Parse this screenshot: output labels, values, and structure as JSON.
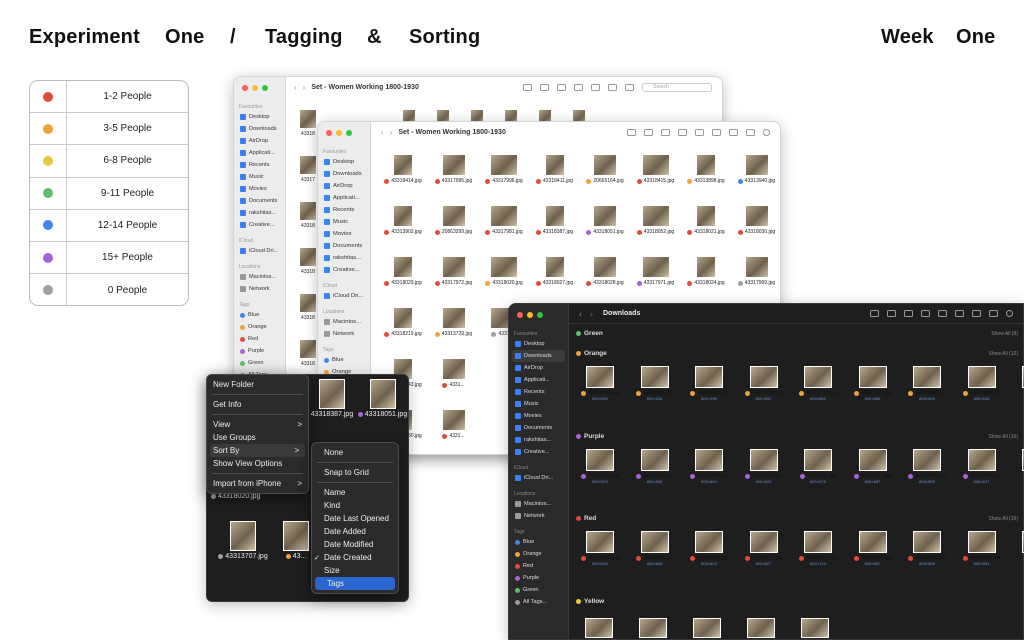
{
  "header": {
    "words": [
      "Experiment",
      "One",
      "/",
      "Tagging",
      "&",
      "Sorting"
    ],
    "right": [
      "Week",
      "One"
    ]
  },
  "legend": [
    {
      "label": "1-2 People",
      "color": "#e04b3c"
    },
    {
      "label": "3-5 People",
      "color": "#f0a23c"
    },
    {
      "label": "6-8 People",
      "color": "#e9c93c"
    },
    {
      "label": "9-11 People",
      "color": "#5cc06a"
    },
    {
      "label": "12-14 People",
      "color": "#3f86e8"
    },
    {
      "label": "15+ People",
      "color": "#a764d6"
    },
    {
      "label": "0 People",
      "color": "#a0a0a0"
    }
  ],
  "sidebar": {
    "favourites": "Favourites",
    "icloud": "iCloud",
    "locations": "Locations",
    "tags": "Tags",
    "fav_items": [
      "Desktop",
      "Downloads",
      "AirDrop",
      "Applicati...",
      "Recents",
      "Music",
      "Movies",
      "Documents",
      "rakshitas...",
      "Creative..."
    ],
    "icloud_items": [
      "iCloud Dri..."
    ],
    "loc_items": [
      "Macintos...",
      "Network"
    ],
    "tag_items": [
      {
        "label": "Blue",
        "color": "#3f86e8"
      },
      {
        "label": "Orange",
        "color": "#f0a23c"
      },
      {
        "label": "Red",
        "color": "#e04b3c"
      },
      {
        "label": "Purple",
        "color": "#a764d6"
      },
      {
        "label": "Green",
        "color": "#5cc06a"
      },
      {
        "label": "All Tags...",
        "color": "#999999"
      }
    ]
  },
  "back_window": {
    "title": "Set - Women Working 1800-1930",
    "search": "Search"
  },
  "front_window": {
    "title": "Set - Women Working 1800-1930",
    "rows": [
      [
        {
          "n": "43318414.jpg",
          "c": "#e04b3c"
        },
        {
          "n": "43317995.jpg",
          "c": "#e04b3c"
        },
        {
          "n": "43317996.jpg",
          "c": "#e04b3c"
        },
        {
          "n": "43318411.jpg",
          "c": "#e04b3c"
        },
        {
          "n": "20665164.jpg",
          "c": "#f0a23c"
        },
        {
          "n": "43318415.jpg",
          "c": "#e04b3c"
        },
        {
          "n": "43313898.jpg",
          "c": "#f0a23c"
        },
        {
          "n": "43313940.jpg",
          "c": "#3f86e8"
        }
      ],
      [
        {
          "n": "43313902.jpg",
          "c": "#e04b3c"
        },
        {
          "n": "20863299.jpg",
          "c": "#e04b3c"
        },
        {
          "n": "43317981.jpg",
          "c": "#e04b3c"
        },
        {
          "n": "43318387.jpg",
          "c": "#e04b3c"
        },
        {
          "n": "43318051.jpg",
          "c": "#a764d6"
        },
        {
          "n": "43318052.jpg",
          "c": "#e04b3c"
        },
        {
          "n": "43318021.jpg",
          "c": "#e04b3c"
        },
        {
          "n": "43318030.jpg",
          "c": "#e04b3c"
        }
      ],
      [
        {
          "n": "43318029.jpg",
          "c": "#e04b3c"
        },
        {
          "n": "43317972.jpg",
          "c": "#e04b3c"
        },
        {
          "n": "43318020.jpg",
          "c": "#f0a23c"
        },
        {
          "n": "43318027.jpg",
          "c": "#e04b3c"
        },
        {
          "n": "43318028.jpg",
          "c": "#e04b3c"
        },
        {
          "n": "43317971.jpg",
          "c": "#a764d6"
        },
        {
          "n": "43318024.jpg",
          "c": "#e04b3c"
        },
        {
          "n": "43317969.jpg",
          "c": "#a0a0a0"
        }
      ],
      [
        {
          "n": "43318219.jpg",
          "c": "#e04b3c"
        },
        {
          "n": "43313729.jpg",
          "c": "#f0a23c"
        },
        {
          "n": "43313...",
          "c": "#a0a0a0"
        }
      ],
      [
        {
          "n": "43318443.jpg",
          "c": "#e04b3c"
        },
        {
          "n": "4331...",
          "c": "#e04b3c"
        }
      ],
      [
        {
          "n": "43318130.jpg",
          "c": "#5cc06a"
        },
        {
          "n": "4331...",
          "c": "#e04b3c"
        }
      ]
    ]
  },
  "behind_labels": [
    "43318",
    "43317",
    "43318",
    "43318",
    "43318",
    "43318"
  ],
  "ctx_bg": {
    "top": [
      {
        "n": "43318387.jpg",
        "c": ""
      },
      {
        "n": "43318051.jpg",
        "c": "#a764d6"
      }
    ],
    "mid": {
      "n": "43318020.jpg",
      "c": "#a0a0a0"
    },
    "bottom": [
      {
        "n": "43313707.jpg",
        "c": "#a0a0a0"
      },
      {
        "n": "43...",
        "c": "#f0a23c"
      }
    ]
  },
  "context_menu": {
    "items": [
      "New Folder",
      "Get Info",
      "View",
      "Use Groups",
      "Sort By",
      "Show View Options",
      "Import from iPhone"
    ],
    "arrow": ">"
  },
  "submenu": {
    "items": [
      "None",
      "Snap to Grid",
      "Name",
      "Kind",
      "Date Last Opened",
      "Date Added",
      "Date Modified",
      "Date Created",
      "Size",
      "Tags"
    ],
    "check": "✓"
  },
  "downloads": {
    "title": "Downloads",
    "show_all": "Show All",
    "groups": [
      {
        "name": "Green",
        "color": "#5cc06a",
        "count": "(9)",
        "items": []
      },
      {
        "name": "Orange",
        "color": "#f0a23c",
        "count": "(12)",
        "items": [
          {
            "n": "20665164.jpg",
            "d": "800×550"
          },
          {
            "n": "43313655.jpg",
            "d": "800×628"
          },
          {
            "n": "43313668.jpg",
            "d": "800×990"
          },
          {
            "n": "43313729.jpg",
            "d": "800×650"
          },
          {
            "n": "43313733.jpg",
            "d": "800×659"
          },
          {
            "n": "43313760.jpg",
            "d": "800×585"
          },
          {
            "n": "43318020.jpg",
            "d": "800×669"
          },
          {
            "n": "43318029.jpg",
            "d": "800×635"
          },
          {
            "n": "433...",
            "d": ""
          }
        ]
      },
      {
        "name": "Purple",
        "color": "#a764d6",
        "count": "(16)",
        "items": [
          {
            "n": "20665277.jpg",
            "d": "800×570"
          },
          {
            "n": "43313667.jpg",
            "d": "800×545"
          },
          {
            "n": "43313704.jpg",
            "d": "800×664"
          },
          {
            "n": "43313709.jpg",
            "d": "800×620"
          },
          {
            "n": "43313811.jpg",
            "d": "800×578"
          },
          {
            "n": "43313817.jpg",
            "d": "800×687"
          },
          {
            "n": "43313899.jpg",
            "d": "800×583"
          },
          {
            "n": "43313906.jpg",
            "d": "800×637"
          },
          {
            "n": "433...",
            "d": ""
          }
        ]
      },
      {
        "name": "Red",
        "color": "#e04b3c",
        "count": "(19)",
        "items": [
          {
            "n": "20668108.jpg",
            "d": "800×645"
          },
          {
            "n": "20863299.jpg",
            "d": "800×608"
          },
          {
            "n": "43313693.jpg",
            "d": "800×623"
          },
          {
            "n": "43313727.jpg",
            "d": "800×627"
          },
          {
            "n": "43313728.jpg",
            "d": "800×713"
          },
          {
            "n": "43313898.jpg",
            "d": "800×667"
          },
          {
            "n": "43313902.jpg",
            "d": "800×569"
          },
          {
            "n": "43317981.jpg",
            "d": "800×951"
          },
          {
            "n": "433...",
            "d": ""
          }
        ]
      },
      {
        "name": "Yellow",
        "color": "#e9c93c",
        "count": "",
        "items": []
      }
    ]
  }
}
